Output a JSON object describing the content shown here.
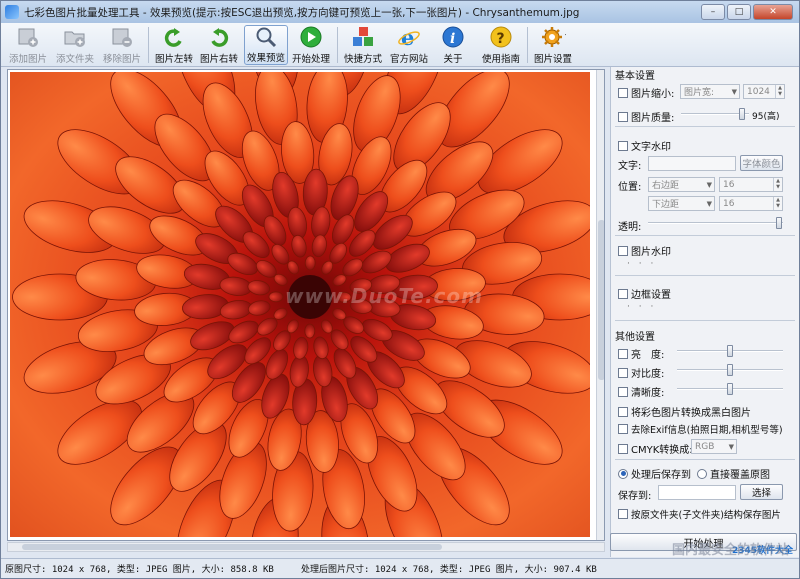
{
  "window": {
    "title": "七彩色图片批量处理工具 - 效果预览(提示:按ESC退出预览,按方向键可预览上一张,下一张图片) - Chrysanthemum.jpg",
    "buttons": {
      "minimize": "–",
      "maximize": "□",
      "close": "✕"
    }
  },
  "toolbar": {
    "items": [
      {
        "label": "添加图片",
        "icon": "add-image-icon",
        "disabled": true
      },
      {
        "label": "添文件夹",
        "icon": "add-folder-icon",
        "disabled": true
      },
      {
        "label": "移除图片",
        "icon": "remove-image-icon",
        "disabled": true
      },
      {
        "label": "图片左转",
        "icon": "rotate-left-icon",
        "disabled": false
      },
      {
        "label": "图片右转",
        "icon": "rotate-right-icon",
        "disabled": false
      },
      {
        "label": "效果预览",
        "icon": "preview-magnifier-icon",
        "disabled": false,
        "active": true
      },
      {
        "label": "开始处理",
        "icon": "play-icon",
        "disabled": false
      },
      {
        "label": "快捷方式",
        "icon": "shortcut-cubes-icon",
        "disabled": false
      },
      {
        "label": "官方网站",
        "icon": "browser-e-icon",
        "disabled": false
      },
      {
        "label": "关于",
        "icon": "info-icon",
        "disabled": false
      },
      {
        "label": "使用指南",
        "icon": "help-icon",
        "disabled": false
      },
      {
        "label": "图片设置",
        "icon": "gear-icon",
        "disabled": false
      }
    ]
  },
  "preview": {
    "watermark": "www.DuoTe.com"
  },
  "panel": {
    "basic": {
      "title": "基本设置",
      "resize_label": "图片缩小:",
      "resize_mode": "图片宽:",
      "resize_value": "1024",
      "quality_label": "图片质量:",
      "quality_value": "95(高)",
      "quality_level": 95
    },
    "text_wm": {
      "title": "文字水印",
      "text_label": "文字:",
      "text_value": "",
      "color_button": "字体颜色",
      "position_label": "位置:",
      "pos_h": "右边距",
      "pos_h_value": "16",
      "pos_v": "下边距",
      "pos_v_value": "16",
      "opacity_label": "透明:",
      "opacity_level": 100
    },
    "image_wm": {
      "title": "图片水印",
      "dots": "· · ·"
    },
    "border": {
      "title": "边框设置",
      "dots": "· · ·"
    },
    "other": {
      "title": "其他设置",
      "brightness": "亮　度:",
      "brightness_level": 50,
      "contrast": "对比度:",
      "contrast_level": 50,
      "sharpness": "清晰度:",
      "sharpness_level": 50,
      "to_bw": "将彩色图片转换成黑白图片",
      "remove_exif": "去除Exif信息(拍照日期,相机型号等)",
      "cmyk": "CMYK转换成:",
      "cmyk_value": "RGB"
    },
    "output": {
      "save_to_radio": "处理后保存到",
      "overwrite_radio": "直接覆盖原图",
      "save_to_label": "保存到:",
      "save_to_value": "",
      "browse_button": "选择",
      "keep_structure": "按原文件夹(子文件夹)结构保存图片"
    },
    "start_button": "开始处理"
  },
  "status": {
    "original": "原图尺寸: 1024 x 768, 类型: JPEG 图片, 大小: 858.8 KB",
    "processed": "处理后图片尺寸: 1024 x 768, 类型: JPEG 图片, 大小: 907.4 KB"
  },
  "branding": {
    "site": "2345软件大全",
    "tagline": "国内最安全的软件站"
  },
  "colors": {
    "accent": "#2c64b8",
    "flower_center": "#8a0c08",
    "flower_petal": "#e84a1c"
  }
}
